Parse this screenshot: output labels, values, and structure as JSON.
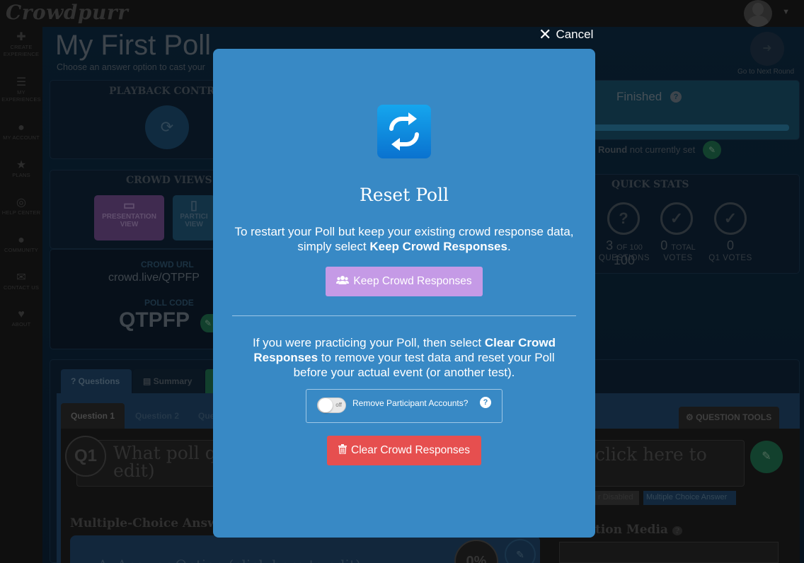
{
  "app": {
    "logo": "Crowdpurr"
  },
  "sidebar": {
    "items": [
      {
        "icon": "plus-icon",
        "label_lines": [
          "CREATE",
          "EXPERIENCE"
        ]
      },
      {
        "icon": "list-icon",
        "label_lines": [
          "MY",
          "EXPERIENCES"
        ]
      },
      {
        "icon": "user-icon",
        "label_lines": [
          "MY ACCOUNT"
        ]
      },
      {
        "icon": "star-icon",
        "label_lines": [
          "PLANS"
        ]
      },
      {
        "icon": "lifebuoy-icon",
        "label_lines": [
          "HELP CENTER"
        ]
      },
      {
        "icon": "chat-icon",
        "label_lines": [
          "COMMUNITY"
        ]
      },
      {
        "icon": "envelope-icon",
        "label_lines": [
          "CONTACT US"
        ]
      },
      {
        "icon": "heart-icon",
        "label_lines": [
          "ABOUT"
        ]
      }
    ]
  },
  "background": {
    "title": "My First Poll",
    "subtitle": "Choose an answer option to cast your",
    "next_round_label": "Go to Next Round",
    "playback_header": "PLAYBACK CONTR",
    "status_label": "Finished",
    "round_prefix": "Round",
    "round_suffix": "not currently set",
    "crowd_views_header": "CROWD VIEWS",
    "presentation_view": [
      "PRESENTATION",
      "VIEW"
    ],
    "participant_view": [
      "PARTICI",
      "VIEW"
    ],
    "crowd_url_label": "CROWD URL",
    "crowd_url": "crowd.live/QTPFP",
    "poll_code_label": "POLL CODE",
    "poll_code": "QTPFP",
    "quick_stats_header": "QUICK STATS",
    "stats": [
      {
        "value": "3",
        "value_suffix": "OF 100",
        "label": "QUESTIONS"
      },
      {
        "value": "0",
        "value_suffix": "TOTAL",
        "label": "VOTES"
      },
      {
        "value": "0",
        "value_suffix": "",
        "label": "Q1 VOTES"
      }
    ],
    "tabs": [
      "Questions",
      "Summary"
    ],
    "question_tabs": [
      "Question 1",
      "Question 2",
      "Que"
    ],
    "question_tools": "QUESTION TOOLS",
    "q_badge": "Q1",
    "q_text_left": "What poll q",
    "q_text_left2": "edit)",
    "q_text_right": "click here to",
    "disabled_tag": "r Disabled",
    "mc_tag": "Multiple Choice Answer",
    "mc_header": "Multiple-Choice Answe",
    "media_header": "tion Media",
    "percent": "0%",
    "answer_option": "A. Answer Option (click here to edit)"
  },
  "modal": {
    "cancel_label": "Cancel",
    "title": "Reset Poll",
    "p1_text": "To restart your Poll but keep your existing crowd response data, simply select ",
    "p1_bold": "Keep Crowd Responses",
    "p1_end": ".",
    "keep_button": "Keep Crowd Responses",
    "p2_text": "If you were practicing your Poll, then select ",
    "p2_bold": "Clear Crowd Responses",
    "p2_end": " to remove your test data and reset your Poll before your actual event (or another test).",
    "toggle_state": "off",
    "toggle_label": "Remove Participant Accounts?",
    "help_glyph": "?",
    "clear_button": "Clear Crowd Responses"
  },
  "colors": {
    "modal_bg": "#3889c5",
    "keep_button": "#c59ae6",
    "clear_button": "#e64f4f",
    "icon_gradient_top": "#15a6ee"
  }
}
